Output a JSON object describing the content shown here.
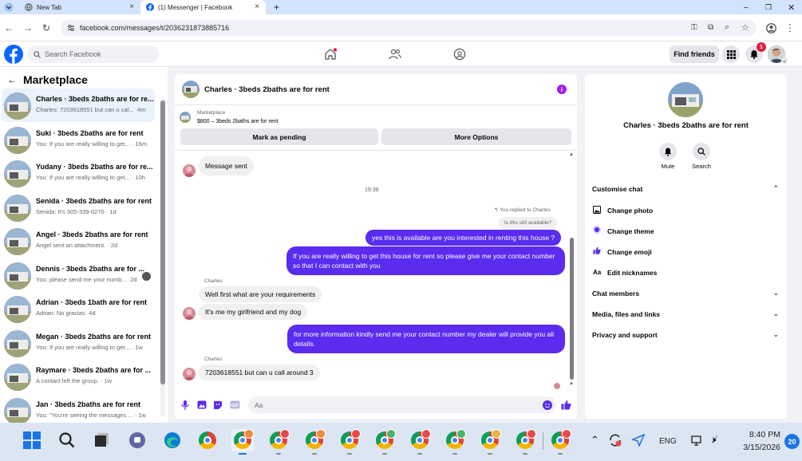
{
  "browser": {
    "tabs": [
      {
        "title": "New Tab",
        "active": false
      },
      {
        "title": "(1) Messenger | Facebook",
        "active": true
      }
    ],
    "url": "facebook.com/messages/t/2036231873885716"
  },
  "facebook": {
    "search_placeholder": "Search Facebook",
    "find_friends": "Find friends",
    "notification_count": "1"
  },
  "sidebar": {
    "title": "Marketplace",
    "conversations": [
      {
        "name": "Charles · 3beds 2baths are for re...",
        "preview": "Charles: 7203618551 but can u cal... ·4m",
        "selected": true
      },
      {
        "name": "Suki · 3beds 2baths are for rent",
        "preview": "You: If you are really willing to get... · 16m"
      },
      {
        "name": "Yudany · 3beds 2baths are for re...",
        "preview": "You: If you are really willing to get... · 10h"
      },
      {
        "name": "Senida · 3beds 2baths are for rent",
        "preview": "Senida: It's 505-339-0270 · 1d"
      },
      {
        "name": "Angel · 3beds 2baths are for rent",
        "preview": "Angel sent an attachment. · 2d"
      },
      {
        "name": "Dennis · 3beds 2baths are for ...",
        "preview": "You: please send me your numb... ·2d"
      },
      {
        "name": "Adrian · 3beds 1bath are for rent",
        "preview": "Adrian: No gracias ·4d"
      },
      {
        "name": "Megan · 3beds 2baths are for rent",
        "preview": "You: If you are really willing to get ... ·1w"
      },
      {
        "name": "Raymare · 3beds 2baths are for ...",
        "preview": "A contact left the group. · 1w"
      },
      {
        "name": "Jan · 3beds 2baths are for rent",
        "preview": "You: \"You're seeing the messages ... · 1w"
      }
    ]
  },
  "chat": {
    "title": "Charles · 3beds 2baths are for rent",
    "listing_label": "Marketplace",
    "listing_detail": "$800 – 3beds 2baths are for rent",
    "mark_pending": "Mark as pending",
    "more_options": "More Options",
    "messages": {
      "m1": "Message sent",
      "time": "19:38",
      "replied_note": "You replied to Charles",
      "quoted": "Is this still available?",
      "m2": "yes this is available are you interested in renting this house ?",
      "m3": "If you are really willing to get this house for rent so please give me your contact number so that I  can contact with you",
      "sender1": "Charles",
      "m4": "Well first what are your requirements",
      "m5": "It's me my girlfriend and my dog",
      "m6": "for more information kindly send me your contact number my dealer will provide you all  details.",
      "sender2": "Charles",
      "m7": "7203618551 but can u call around 3"
    },
    "composer_placeholder": "Aa"
  },
  "details": {
    "title": "Charles · 3beds 2baths are for rent",
    "mute": "Mute",
    "search": "Search",
    "customise_chat": "Customise chat",
    "change_photo": "Change photo",
    "change_theme": "Change theme",
    "change_emoji": "Change emoji",
    "edit_nicknames": "Edit nicknames",
    "aa_icon": "Aa",
    "chat_members": "Chat members",
    "media": "Media, files and links",
    "privacy": "Privacy and support"
  },
  "taskbar": {
    "lang": "ENG",
    "time": "8:40 PM",
    "date": "3/15/2026",
    "notif_count": "20"
  },
  "colors": {
    "accent": "#5b2bf0",
    "fb_blue": "#0866ff",
    "tab_strip": "#d3e3fd"
  }
}
